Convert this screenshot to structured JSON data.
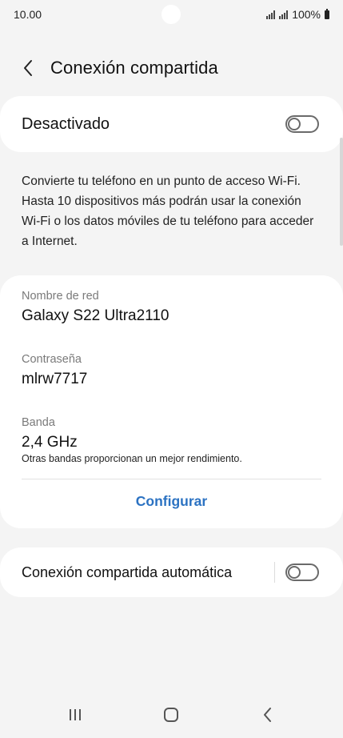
{
  "status_bar": {
    "time": "10.00",
    "battery": "100%"
  },
  "header": {
    "title": "Conexión compartida",
    "back_icon": "chevron-left-icon"
  },
  "master_switch": {
    "label": "Desactivado",
    "state": "off"
  },
  "description": "Convierte tu teléfono en un punto de acceso Wi-Fi. Hasta 10 dispositivos más podrán usar la conexión Wi-Fi o los datos móviles de tu teléfono para acceder a Internet.",
  "network": {
    "name_label": "Nombre de red",
    "name_value": "Galaxy S22 Ultra2110",
    "password_label": "Contraseña",
    "password_value": "mlrw7717",
    "band_label": "Banda",
    "band_value": "2,4 GHz",
    "band_note": "Otras bandas proporcionan un mejor rendimiento.",
    "configure_label": "Configurar"
  },
  "auto_hotspot": {
    "label": "Conexión compartida automática",
    "state": "off"
  },
  "nav_bar": {
    "recents_icon": "recents-icon",
    "home_icon": "home-icon",
    "back_icon": "back-icon"
  },
  "colors": {
    "background": "#f4f4f4",
    "card": "#ffffff",
    "accent": "#2b72c2",
    "secondary_text": "#7a7a7a"
  }
}
